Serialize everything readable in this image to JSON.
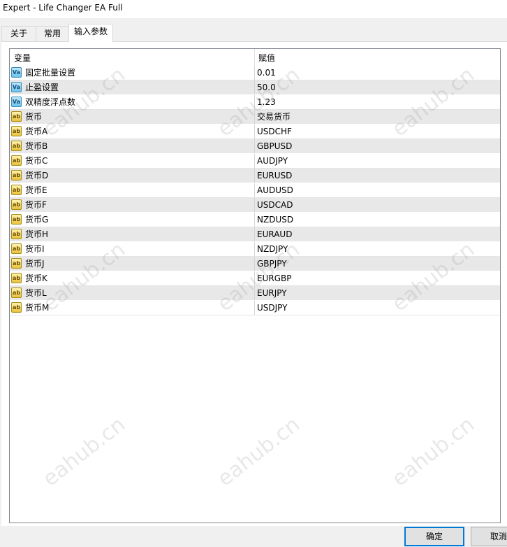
{
  "window": {
    "title": "Expert - Life Changer EA Full"
  },
  "tabs": [
    {
      "label": "关于",
      "active": false
    },
    {
      "label": "常用",
      "active": false
    },
    {
      "label": "输入参数",
      "active": true
    }
  ],
  "grid": {
    "columns": [
      "变量",
      "赋值"
    ],
    "rows": [
      {
        "icon": "numeric-param-icon",
        "name": "固定批量设置",
        "value": "0.01"
      },
      {
        "icon": "numeric-param-icon",
        "name": "止盈设置",
        "value": "50.0"
      },
      {
        "icon": "numeric-param-icon",
        "name": "双精度浮点数",
        "value": "1.23"
      },
      {
        "icon": "string-param-icon",
        "name": "货币",
        "value": "交易货币"
      },
      {
        "icon": "string-param-icon",
        "name": "货币A",
        "value": "USDCHF"
      },
      {
        "icon": "string-param-icon",
        "name": "货币B",
        "value": "GBPUSD"
      },
      {
        "icon": "string-param-icon",
        "name": "货币C",
        "value": "AUDJPY"
      },
      {
        "icon": "string-param-icon",
        "name": "货币D",
        "value": "EURUSD"
      },
      {
        "icon": "string-param-icon",
        "name": "货币E",
        "value": "AUDUSD"
      },
      {
        "icon": "string-param-icon",
        "name": "货币F",
        "value": "USDCAD"
      },
      {
        "icon": "string-param-icon",
        "name": "货币G",
        "value": "NZDUSD"
      },
      {
        "icon": "string-param-icon",
        "name": "货币H",
        "value": "EURAUD"
      },
      {
        "icon": "string-param-icon",
        "name": "货币I",
        "value": "NZDJPY"
      },
      {
        "icon": "string-param-icon",
        "name": "货币J",
        "value": "GBPJPY"
      },
      {
        "icon": "string-param-icon",
        "name": "货币K",
        "value": "EURGBP"
      },
      {
        "icon": "string-param-icon",
        "name": "货币L",
        "value": "EURJPY"
      },
      {
        "icon": "string-param-icon",
        "name": "货币M",
        "value": "USDJPY"
      }
    ]
  },
  "buttons": {
    "ok": "确定",
    "cancel": "取消"
  },
  "watermark": "eahub.cn",
  "colors": {
    "accent": "#0078d7",
    "alt_row": "#e8e8e8"
  }
}
